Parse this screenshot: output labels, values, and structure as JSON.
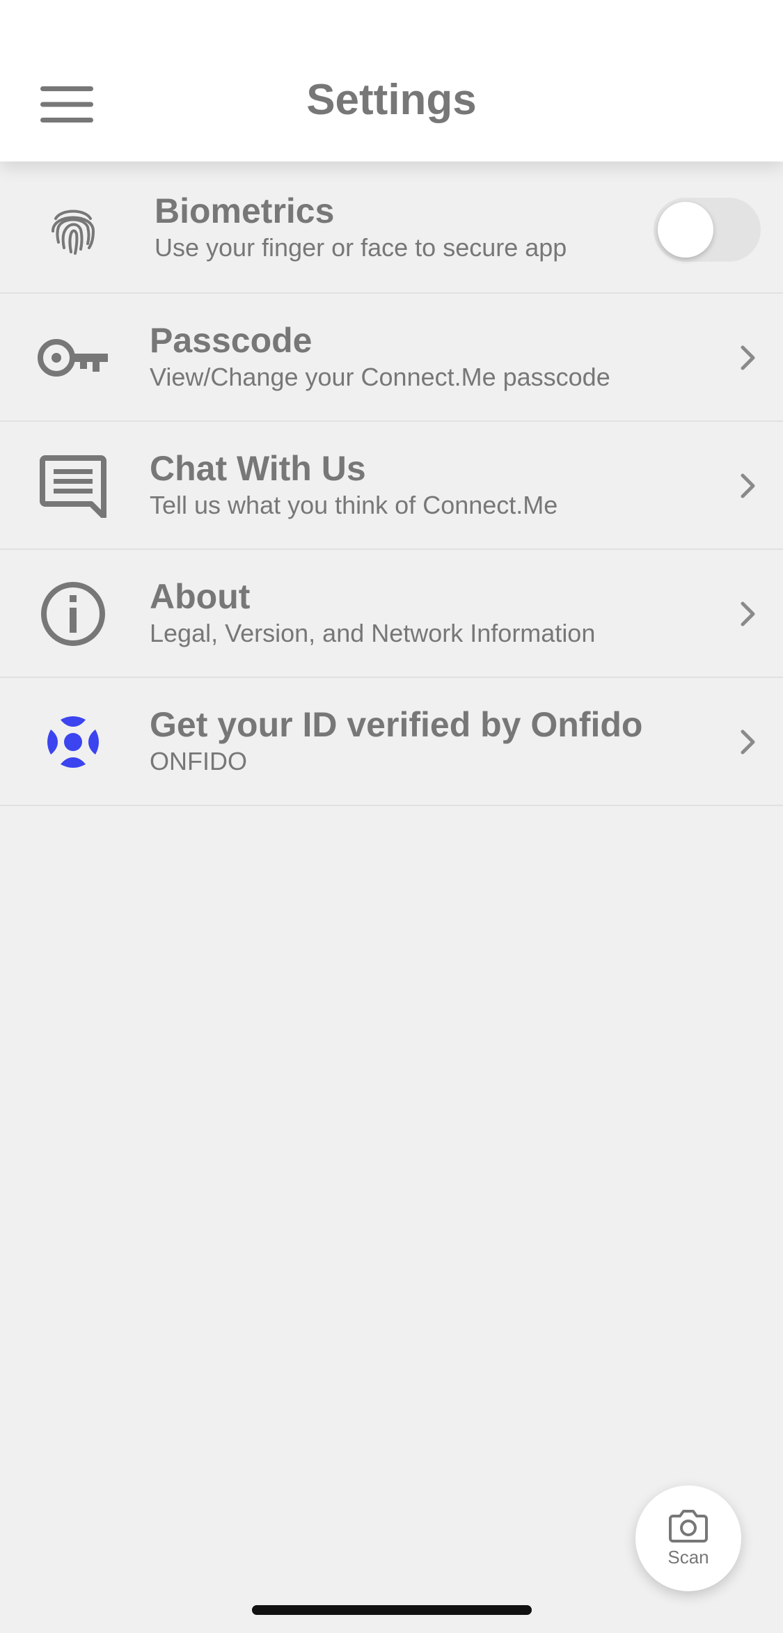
{
  "header": {
    "title": "Settings",
    "menu_icon": "hamburger-menu-icon"
  },
  "settings": {
    "biometrics": {
      "icon": "fingerprint-icon",
      "title": "Biometrics",
      "subtitle": "Use your finger or face to secure app",
      "enabled": false
    },
    "passcode": {
      "icon": "key-icon",
      "title": "Passcode",
      "subtitle": "View/Change your Connect.Me passcode"
    },
    "chat": {
      "icon": "chat-message-icon",
      "title": "Chat With Us",
      "subtitle": "Tell us what you think of Connect.Me"
    },
    "about": {
      "icon": "info-icon",
      "title": "About",
      "subtitle": "Legal, Version, and Network Information"
    },
    "onfido": {
      "icon": "onfido-logo-icon",
      "title": "Get your ID verified by Onfido",
      "subtitle": "ONFIDO"
    }
  },
  "scan": {
    "label": "Scan",
    "icon": "camera-icon"
  },
  "colors": {
    "background": "#f0f0f0",
    "header": "#ffffff",
    "text": "#777777",
    "onfido_accent": "#3b44ef",
    "toggle_off": "#e3e3e3"
  }
}
